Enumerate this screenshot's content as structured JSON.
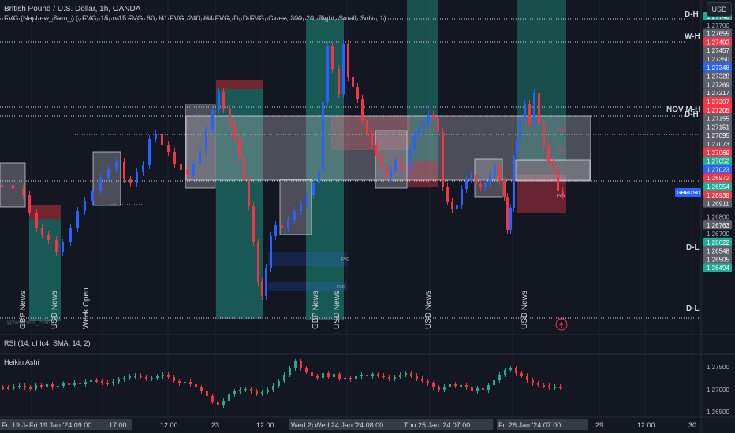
{
  "header": {
    "title": "British Pound / U.S. Dollar, 1h, OANDA",
    "indicator": "FVG (Nephew_Sam_) (, FVG, 15, m15 FVG, 60, H1 FVG, 240, H4 FVG, D, D FVG, Close, 300, 20, Right, Small, Solid, 1)"
  },
  "currency_button": "USD",
  "symbol_tag": "GBPUSD",
  "watermark": "@Nephew_Sam_",
  "level_labels": [
    "D-H",
    "W-H",
    "NOV M-H",
    "D-H",
    "D-L",
    "D-L"
  ],
  "price_scale": [
    {
      "text": "1.27740",
      "bg": "#22ab94"
    },
    {
      "text": "1.27700",
      "bg": ""
    },
    {
      "text": "1.27655",
      "bg": "#5d606b"
    },
    {
      "text": "1.27492",
      "bg": "#f23645"
    },
    {
      "text": "1.27457",
      "bg": "#5d606b"
    },
    {
      "text": "1.27350",
      "bg": "#5d606b"
    },
    {
      "text": "1.27348",
      "bg": "#2962ff"
    },
    {
      "text": "1.27328",
      "bg": "#5d606b"
    },
    {
      "text": "1.27269",
      "bg": "#5d606b"
    },
    {
      "text": "1.27217",
      "bg": "#5d606b"
    },
    {
      "text": "1.27207",
      "bg": "#f23645"
    },
    {
      "text": "1.27205",
      "bg": "#f23645"
    },
    {
      "text": "1.27155",
      "bg": "#5d606b"
    },
    {
      "text": "1.27151",
      "bg": "#5d606b"
    },
    {
      "text": "1.27095",
      "bg": "#5d606b"
    },
    {
      "text": "1.27073",
      "bg": "#5d606b"
    },
    {
      "text": "1.27069",
      "bg": "#f23645"
    },
    {
      "text": "1.27052",
      "bg": "#22ab94"
    },
    {
      "text": "1.27023",
      "bg": "#2962ff"
    },
    {
      "text": "1.26972",
      "bg": "#f23645"
    },
    {
      "text": "1.26954",
      "bg": "#22ab94"
    },
    {
      "text": "1.26939",
      "bg": "#f23645"
    },
    {
      "text": "1.26911",
      "bg": "#5d606b"
    },
    {
      "text": "1.26800",
      "bg": ""
    },
    {
      "text": "1.26763",
      "bg": "#5d606b"
    },
    {
      "text": "1.26700",
      "bg": ""
    },
    {
      "text": "1.26622",
      "bg": "#22ab94"
    },
    {
      "text": "1.26548",
      "bg": "#5d606b"
    },
    {
      "text": "1.26505",
      "bg": "#5d606b"
    },
    {
      "text": "1.26494",
      "bg": "#22ab94"
    }
  ],
  "news_labels": [
    {
      "text": "GBP News"
    },
    {
      "text": "USD News"
    },
    {
      "text": "Week Open"
    },
    {
      "text": "GBP News"
    },
    {
      "text": "USD News"
    },
    {
      "text": "USD News"
    },
    {
      "text": "USD News"
    }
  ],
  "fvg_tag": "FVG",
  "rsi_label": "RSI (14, ohlc4, SMA, 14, 2)",
  "ha_label": "Heikin Ashi",
  "ha_scale": [
    "1.27500",
    "1.27000",
    "1.26500"
  ],
  "time_axis": [
    {
      "text": "Fri 19 Jan '24",
      "highlight": true
    },
    {
      "text": "Fri 19 Jan '24  09:00",
      "highlight": true
    },
    {
      "text": "17:00",
      "highlight": true
    },
    {
      "text": "12:00",
      "highlight": false
    },
    {
      "text": "23",
      "highlight": false
    },
    {
      "text": "12:00",
      "highlight": false
    },
    {
      "text": "Wed 24 Jan '24",
      "highlight": true
    },
    {
      "text": "Wed 24 Jan '24  08:00",
      "highlight": true
    },
    {
      "text": "Thu 25 Jan '24  07:00",
      "highlight": true
    },
    {
      "text": "Fri 26 Jan '24  07:00",
      "highlight": true
    },
    {
      "text": "29",
      "highlight": false
    },
    {
      "text": "12:00",
      "highlight": false
    },
    {
      "text": "30",
      "highlight": false
    }
  ],
  "colors": {
    "background": "#131722",
    "bull": "#2962ff",
    "bear": "#f23645",
    "ha_bull": "#22ab94",
    "ha_bear": "#f23645",
    "grid": "#1e222d"
  }
}
